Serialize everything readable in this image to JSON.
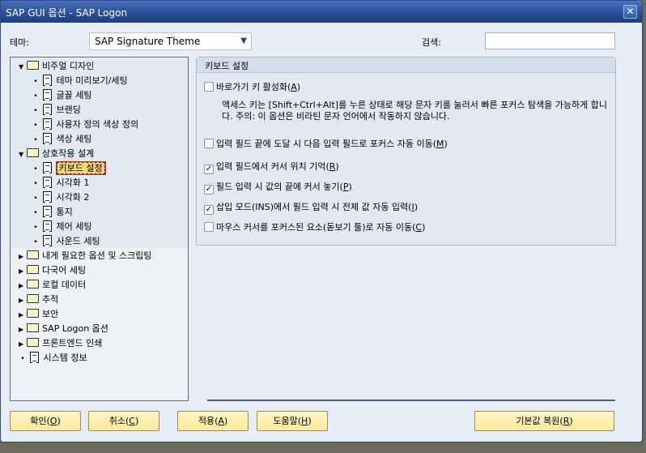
{
  "window": {
    "title": "SAP GUI 옵션 - SAP Logon",
    "close": "✕"
  },
  "theme": {
    "label": "테마:",
    "value": "SAP Signature Theme"
  },
  "search": {
    "label": "검색:",
    "value": ""
  },
  "tree": [
    {
      "label": "비주얼 디자인",
      "type": "folder",
      "level": 0,
      "expanded": true
    },
    {
      "label": "테마 미리보기/세팅",
      "type": "doc",
      "level": 1
    },
    {
      "label": "글꼴 세팅",
      "type": "doc",
      "level": 1
    },
    {
      "label": "브랜딩",
      "type": "doc",
      "level": 1
    },
    {
      "label": "사용자 정의 색상 정의",
      "type": "doc",
      "level": 1
    },
    {
      "label": "색상 세팅",
      "type": "doc",
      "level": 1
    },
    {
      "label": "상호작용 설계",
      "type": "folder",
      "level": 0,
      "expanded": true
    },
    {
      "label": "키보드 설정",
      "type": "doc",
      "level": 1,
      "selected": true
    },
    {
      "label": "시각화 1",
      "type": "doc",
      "level": 1
    },
    {
      "label": "시각화 2",
      "type": "doc",
      "level": 1
    },
    {
      "label": "통지",
      "type": "doc",
      "level": 1
    },
    {
      "label": "제어 세팅",
      "type": "doc",
      "level": 1
    },
    {
      "label": "사운드 세팅",
      "type": "doc",
      "level": 1
    },
    {
      "label": "내게 필요한 옵션 및 스크립팅",
      "type": "folder",
      "level": 0
    },
    {
      "label": "다국어 세팅",
      "type": "folder",
      "level": 0
    },
    {
      "label": "로컬 데이터",
      "type": "folder",
      "level": 0
    },
    {
      "label": "추적",
      "type": "folder",
      "level": 0
    },
    {
      "label": "보안",
      "type": "folder",
      "level": 0
    },
    {
      "label": "SAP Logon 옵션",
      "type": "folder",
      "level": 0
    },
    {
      "label": "프론트엔드 인쇄",
      "type": "folder",
      "level": 0
    },
    {
      "label": "시스템 정보",
      "type": "doc",
      "level": 0
    }
  ],
  "panel": {
    "title": "키보드 설정",
    "options": [
      {
        "label": "바로가기 키 활성화",
        "key": "A",
        "checked": false
      },
      {
        "label": "입력 필드 끝에 도달 시 다음 입력 필드로 포커스 자동 이동",
        "key": "M",
        "checked": false
      },
      {
        "label": "입력 필드에서 커서 위치 기억",
        "key": "R",
        "checked": true
      },
      {
        "label": "필드 입력 시 값의 끝에 커서 놓기",
        "key": "P",
        "checked": true
      },
      {
        "label": "삽입 모드(INS)에서 필드 입력 시 전체 값 자동 입력",
        "key": "I",
        "checked": true
      },
      {
        "label": "마우스 커서를 포커스된 요소(돋보기 툴)로 자동 이동",
        "key": "C",
        "checked": false
      }
    ],
    "description": "액세스 키는 [Shift+Ctrl+Alt]를 누른 상태로 해당 문자 키를 눌러서 빠른 포커스 탐색을 가능하게 합니다. 주의: 이 옵션은 비라틴 문자 언어에서 작동하지 않습니다."
  },
  "buttons": [
    {
      "label": "확인",
      "key": "O"
    },
    {
      "label": "취소",
      "key": "C"
    },
    {
      "label": "적용",
      "key": "A"
    },
    {
      "label": "도움말",
      "key": "H"
    },
    {
      "label": "기본값 복원",
      "key": "R"
    }
  ]
}
